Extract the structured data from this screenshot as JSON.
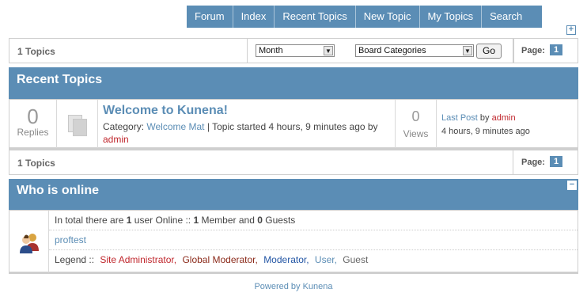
{
  "nav": {
    "tabs": [
      "Forum",
      "Index",
      "Recent Topics",
      "New Topic",
      "My Topics",
      "Search"
    ]
  },
  "expand_symbol": "+",
  "collapse_symbol": "−",
  "top_bar": {
    "count": "1 Topics",
    "time_filter": "Month",
    "category_filter": "Board Categories",
    "go_label": "Go",
    "page_label": "Page:",
    "page_num": "1"
  },
  "recent": {
    "heading": "Recent Topics",
    "topic": {
      "replies_count": "0",
      "replies_label": "Replies",
      "title": "Welcome to Kunena!",
      "category_label": "Category:",
      "category": "Welcome Mat",
      "started_text": "| Topic started 4 hours, 9 minutes ago by",
      "author": "admin",
      "views_count": "0",
      "views_label": "Views",
      "last_post_label": "Last Post",
      "by_label": "by",
      "last_post_author": "admin",
      "last_post_time": "4 hours, 9 minutes ago"
    }
  },
  "bottom_bar": {
    "count": "1 Topics",
    "page_label": "Page:",
    "page_num": "1"
  },
  "online": {
    "heading": "Who is online",
    "summary_prefix": "In total there are",
    "users": "1",
    "summary_mid": "user Online  ::",
    "members": "1",
    "members_label": "Member and",
    "guests": "0",
    "guests_label": "Guests",
    "user_list": [
      "proftest"
    ],
    "legend_label": "Legend ::",
    "legend": [
      "Site Administrator,",
      "Global Moderator,",
      "Moderator,",
      "User,",
      "Guest"
    ]
  },
  "footer": {
    "powered": "Powered by Kunena"
  },
  "colors": {
    "accent": "#5b8db5",
    "admin_red": "#c0272d",
    "global_mod": "#8b2a1a",
    "moderator_blue": "#2255a4",
    "user_blue": "#5b8db5",
    "guest_gray": "#666666"
  }
}
